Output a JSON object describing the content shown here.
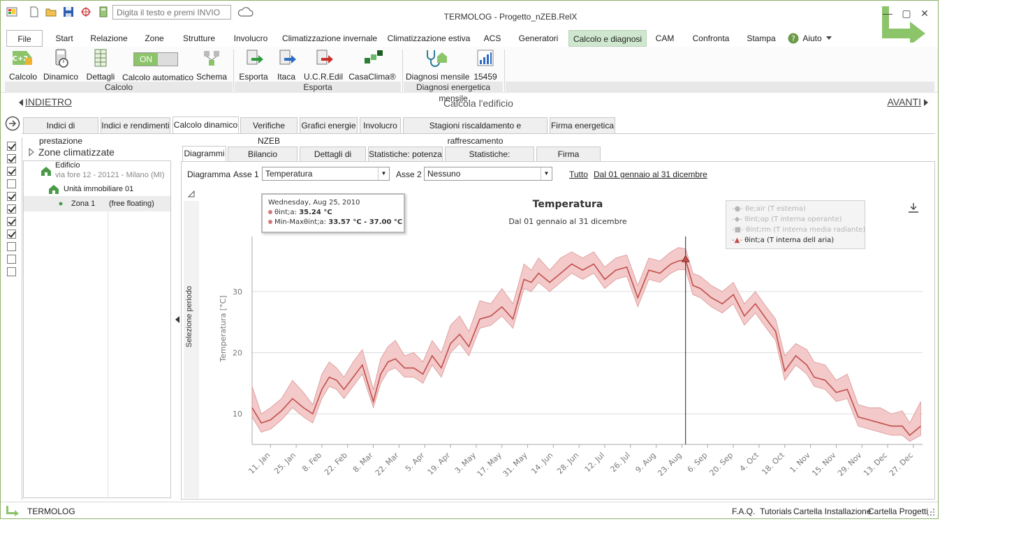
{
  "titlebar": {
    "title": "TERMOLOG - Progetto_nZEB.RelX",
    "search_placeholder": "Digita il testo e premi INVIO",
    "minimize": "—",
    "maximize": "▢",
    "close": "✕"
  },
  "menu": {
    "items": [
      "File",
      "Start",
      "Relazione",
      "Zone",
      "Strutture",
      "Involucro",
      "Climatizzazione invernale",
      "Climatizzazione estiva",
      "ACS",
      "Generatori",
      "Calcolo e diagnosi",
      "CAM",
      "Confronta",
      "Stampa",
      "Aiuto"
    ],
    "active": "Calcolo e diagnosi"
  },
  "ribbon": {
    "buttons": {
      "calcolo": "Calcolo",
      "dinamico": "Dinamico",
      "dettagli": "Dettagli",
      "calcolo_automatico": "Calcolo automatico",
      "schema": "Schema",
      "esporta": "Esporta",
      "itaca": "Itaca",
      "ucredil": "U.C.R.Edil",
      "casaclima": "CasaClima®",
      "diagnosi_mensile": "Diagnosi mensile",
      "n15459": "15459"
    },
    "toggle_label": "ON",
    "calc_badge": "C+2",
    "groups": {
      "calcolo": "Calcolo",
      "esporta": "Esporta",
      "diagnosi": "Diagnosi energetica mensile"
    }
  },
  "nav": {
    "back": "INDIETRO",
    "title": "Calcola l'edificio",
    "forward": "AVANTI"
  },
  "tabs1": [
    "Indici di prestazione",
    "Indici e rendimenti",
    "Calcolo dinamico",
    "Verifiche NZEB",
    "Grafici energie",
    "Involucro",
    "Stagioni riscaldamento e raffrescamento",
    "Firma energetica"
  ],
  "checks": [
    true,
    true,
    true,
    false,
    true,
    true,
    true,
    true,
    false,
    false,
    false
  ],
  "tree": {
    "title": "Zone climatizzate",
    "building": "Edificio",
    "address": "via fore 12 - 20121 - Milano (MI)",
    "unit": "Unità immobiliare 01",
    "zone": "Zona 1",
    "zone_mode": "(free floating)"
  },
  "tabs2": [
    "Diagrammi",
    "Bilancio energetico",
    "Dettagli di calcolo",
    "Statistiche: potenza",
    "Statistiche: temperature",
    "Firma energetica"
  ],
  "controls": {
    "diagramma": "Diagramma",
    "asse1": "Asse 1",
    "asse1_value": "Temperatura",
    "asse2": "Asse 2",
    "asse2_value": "Nessuno",
    "tutto": "Tutto",
    "period": "Dal 01 gennaio al 31 dicembre",
    "selezione_periodo": "Selezione periodo"
  },
  "tooltip": {
    "date": "Wednesday, Aug 25, 2010",
    "line1_label": "θint;a: ",
    "line1_value": "35.24 °C",
    "line2_label": "Min-Maxθint;a: ",
    "line2_value": "33.57 °C - 37.00 °C"
  },
  "chart_data": {
    "type": "line",
    "title": "Temperatura",
    "subtitle": "Dal 01 gennaio al 31 dicembre",
    "ylabel": "Temperatura [°C]",
    "xlabel": "",
    "ylim": [
      5,
      39
    ],
    "yticks": [
      10,
      20,
      30
    ],
    "grid": true,
    "legend_position": "top-right",
    "x_tick_labels": [
      "11. Jan",
      "25. Jan",
      "8. Feb",
      "22. Feb",
      "8. Mar",
      "22. Mar",
      "5. Apr",
      "19. Apr",
      "3. May",
      "17. May",
      "31. May",
      "14. Jun",
      "28. Jun",
      "12. Jul",
      "26. Jul",
      "9. Aug",
      "23. Aug",
      "6. Sep",
      "20. Sep",
      "4. Oct",
      "18. Oct",
      "1. Nov",
      "15. Nov",
      "29. Nov",
      "13. Dec",
      "27. Dec"
    ],
    "x_tick_days": [
      10,
      24,
      38,
      52,
      66,
      80,
      94,
      108,
      122,
      136,
      150,
      164,
      178,
      192,
      206,
      220,
      234,
      248,
      262,
      276,
      290,
      304,
      318,
      332,
      346,
      360
    ],
    "crosshair_day": 236,
    "series": [
      {
        "name": "θe;air (T esterna)",
        "visible": false
      },
      {
        "name": "θint;op (T interna operante)",
        "visible": false
      },
      {
        "name": "θint;rm (T interna media radiante)",
        "visible": false
      },
      {
        "name": "θint;a (T interna dell aria)",
        "visible": true,
        "color": "#c0504d",
        "days": [
          0,
          5,
          10,
          16,
          22,
          28,
          33,
          38,
          42,
          46,
          50,
          55,
          60,
          66,
          70,
          74,
          78,
          83,
          88,
          93,
          98,
          103,
          108,
          113,
          118,
          124,
          130,
          136,
          142,
          148,
          152,
          156,
          162,
          168,
          174,
          180,
          186,
          192,
          198,
          204,
          210,
          216,
          222,
          228,
          232,
          236,
          240,
          244,
          250,
          256,
          262,
          268,
          274,
          280,
          285,
          290,
          296,
          302,
          306,
          312,
          318,
          324,
          330,
          336,
          342,
          348,
          354,
          358,
          364
        ],
        "mean": [
          11.0,
          8.5,
          9.0,
          10.5,
          12.5,
          11.0,
          10.0,
          14.0,
          16.0,
          15.5,
          14.0,
          16.0,
          18.0,
          12.0,
          16.5,
          18.5,
          19.0,
          17.5,
          17.5,
          16.5,
          19.5,
          17.5,
          21.5,
          23.0,
          21.0,
          25.5,
          26.0,
          27.5,
          25.5,
          32.0,
          31.5,
          33.0,
          31.5,
          33.0,
          34.5,
          33.5,
          34.5,
          32.0,
          33.5,
          34.0,
          29.0,
          33.5,
          33.0,
          34.5,
          35.0,
          35.2,
          31.0,
          30.5,
          29.0,
          28.0,
          29.5,
          26.0,
          28.0,
          25.5,
          23.5,
          17.0,
          19.5,
          18.0,
          16.0,
          15.5,
          13.5,
          14.0,
          9.5,
          9.0,
          8.5,
          8.0,
          8.0,
          6.5,
          8.0
        ],
        "min": [
          9.5,
          7.0,
          7.5,
          9.0,
          11.0,
          9.5,
          8.5,
          12.5,
          14.5,
          14.0,
          12.5,
          14.5,
          16.5,
          11.0,
          15.0,
          17.0,
          17.5,
          16.0,
          16.0,
          15.0,
          18.0,
          16.0,
          20.0,
          21.5,
          19.5,
          24.0,
          24.5,
          26.0,
          24.0,
          30.5,
          30.0,
          31.5,
          30.0,
          31.5,
          33.0,
          32.0,
          33.0,
          30.5,
          32.0,
          32.5,
          27.5,
          32.0,
          31.5,
          33.0,
          33.6,
          33.57,
          29.5,
          29.0,
          27.5,
          26.5,
          28.0,
          24.5,
          26.5,
          24.0,
          22.0,
          15.5,
          18.0,
          16.5,
          14.5,
          14.0,
          12.0,
          12.5,
          8.0,
          7.5,
          7.0,
          6.5,
          6.5,
          5.5,
          6.5
        ],
        "max": [
          14.5,
          10.0,
          11.0,
          12.5,
          15.5,
          13.5,
          11.5,
          16.5,
          18.5,
          17.5,
          16.0,
          18.5,
          20.5,
          14.0,
          19.0,
          21.0,
          22.0,
          19.5,
          20.0,
          18.5,
          22.0,
          20.0,
          24.5,
          26.0,
          23.5,
          28.5,
          28.0,
          30.5,
          28.0,
          34.5,
          33.5,
          35.5,
          33.5,
          35.5,
          36.5,
          35.5,
          36.5,
          34.0,
          35.5,
          36.0,
          31.0,
          35.5,
          35.0,
          36.5,
          37.2,
          37.0,
          33.0,
          32.5,
          31.0,
          30.0,
          31.5,
          28.0,
          30.0,
          27.5,
          25.5,
          19.5,
          21.5,
          20.5,
          18.5,
          18.0,
          15.5,
          16.5,
          11.5,
          11.0,
          11.0,
          10.0,
          10.5,
          8.5,
          12.0
        ]
      }
    ]
  },
  "status": {
    "app": "TERMOLOG",
    "faq": "F.A.Q.",
    "tutorials": "Tutorials",
    "installazione": "Cartella Installazione",
    "progetti": "Cartella Progetti"
  }
}
